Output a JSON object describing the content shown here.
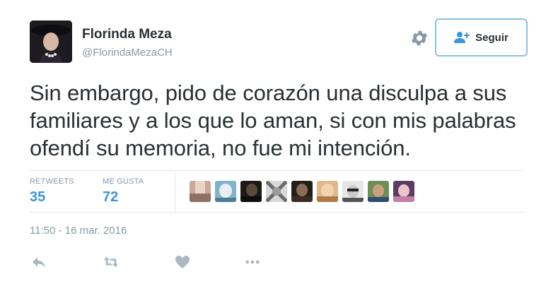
{
  "user": {
    "name": "Florinda Meza",
    "handle": "@FlorindaMezaCH"
  },
  "follow_button": {
    "label": "Seguir"
  },
  "tweet": {
    "text": "Sin embargo, pido de corazón una disculpa a sus familiares y a los que lo aman, si con mis palabras ofendí su memoria, no fue mi intención.",
    "timestamp": "11:50 - 16 mar. 2016"
  },
  "stats": {
    "retweets_label": "RETWEETS",
    "retweets_value": "35",
    "likes_label": "ME GUSTA",
    "likes_value": "72"
  },
  "colors": {
    "accent": "#3b94d9",
    "muted": "#8899a6",
    "button_border": "#86c3e6"
  },
  "favoriters": [
    {
      "icon": "user-avatar"
    },
    {
      "icon": "user-avatar"
    },
    {
      "icon": "user-avatar"
    },
    {
      "icon": "user-avatar"
    },
    {
      "icon": "user-avatar"
    },
    {
      "icon": "user-avatar"
    },
    {
      "icon": "user-avatar"
    },
    {
      "icon": "user-avatar"
    },
    {
      "icon": "user-avatar"
    }
  ],
  "actions": [
    {
      "icon": "reply-icon"
    },
    {
      "icon": "retweet-icon"
    },
    {
      "icon": "heart-icon"
    },
    {
      "icon": "more-icon"
    }
  ]
}
